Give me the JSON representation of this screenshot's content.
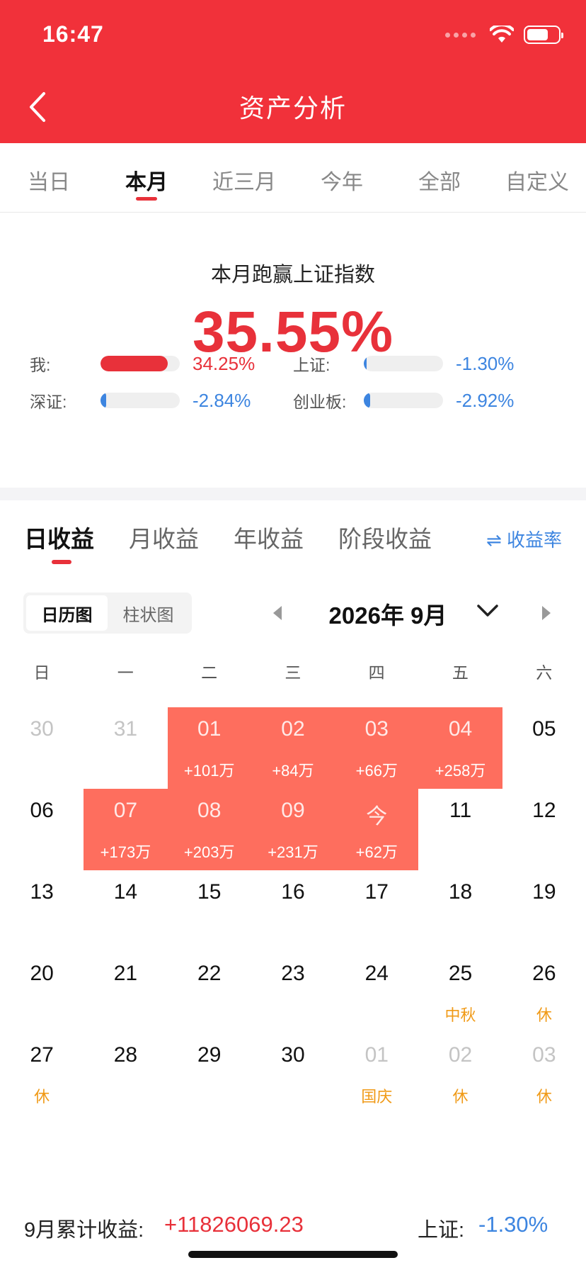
{
  "status": {
    "time": "16:47"
  },
  "header": {
    "title": "资产分析"
  },
  "period_tabs": [
    {
      "label": "当日",
      "active": false
    },
    {
      "label": "本月",
      "active": true
    },
    {
      "label": "近三月",
      "active": false
    },
    {
      "label": "今年",
      "active": false
    },
    {
      "label": "全部",
      "active": false
    },
    {
      "label": "自定义",
      "active": false
    }
  ],
  "summary": {
    "title": "本月跑赢上证指数",
    "value": "35.55%",
    "comparisons": [
      {
        "id": "me",
        "label": "我:",
        "value": "34.25%",
        "fill": 0.85,
        "color": "#e8313a",
        "tone": "red"
      },
      {
        "id": "sh",
        "label": "上证:",
        "value": "-1.30%",
        "fill": 0.03,
        "color": "#3d85e0",
        "tone": "blue"
      },
      {
        "id": "sz",
        "label": "深证:",
        "value": "-2.84%",
        "fill": 0.07,
        "color": "#3d85e0",
        "tone": "blue"
      },
      {
        "id": "cyb",
        "label": "创业板:",
        "value": "-2.92%",
        "fill": 0.08,
        "color": "#3d85e0",
        "tone": "blue"
      }
    ]
  },
  "earnings_tabs": [
    {
      "label": "日收益",
      "active": true
    },
    {
      "label": "月收益",
      "active": false
    },
    {
      "label": "年收益",
      "active": false
    },
    {
      "label": "阶段收益",
      "active": false
    }
  ],
  "rate_toggle": "⇌ 收益率",
  "view_toggle": {
    "calendar": "日历图",
    "bar": "柱状图"
  },
  "month_nav": {
    "label": "2026年 9月"
  },
  "weekdays": [
    "日",
    "一",
    "二",
    "三",
    "四",
    "五",
    "六"
  ],
  "calendar": [
    [
      {
        "day": "30",
        "other": true
      },
      {
        "day": "31",
        "other": true
      },
      {
        "day": "01",
        "gain": "+101万"
      },
      {
        "day": "02",
        "gain": "+84万"
      },
      {
        "day": "03",
        "gain": "+66万"
      },
      {
        "day": "04",
        "gain": "+258万"
      },
      {
        "day": "05"
      }
    ],
    [
      {
        "day": "06"
      },
      {
        "day": "07",
        "gain": "+173万"
      },
      {
        "day": "08",
        "gain": "+203万"
      },
      {
        "day": "09",
        "gain": "+231万"
      },
      {
        "day": "今",
        "gain": "+62万"
      },
      {
        "day": "11"
      },
      {
        "day": "12"
      }
    ],
    [
      {
        "day": "13"
      },
      {
        "day": "14"
      },
      {
        "day": "15"
      },
      {
        "day": "16"
      },
      {
        "day": "17"
      },
      {
        "day": "18"
      },
      {
        "day": "19"
      }
    ],
    [
      {
        "day": "20"
      },
      {
        "day": "21"
      },
      {
        "day": "22"
      },
      {
        "day": "23"
      },
      {
        "day": "24"
      },
      {
        "day": "25",
        "note": "中秋"
      },
      {
        "day": "26",
        "note": "休"
      }
    ],
    [
      {
        "day": "27",
        "note": "休"
      },
      {
        "day": "28"
      },
      {
        "day": "29"
      },
      {
        "day": "30"
      },
      {
        "day": "01",
        "other": true,
        "note": "国庆"
      },
      {
        "day": "02",
        "other": true,
        "note": "休"
      },
      {
        "day": "03",
        "other": true,
        "note": "休"
      }
    ]
  ],
  "footer": {
    "cumulative_label": "9月累计收益:",
    "cumulative_value": "+11826069.23",
    "index_label": "上证:",
    "index_value": "-1.30%"
  },
  "colors": {
    "brand_red": "#f1313a",
    "gain_cell": "#fe6e5e",
    "negative_blue": "#3d85e0",
    "holiday_orange": "#f09a17"
  },
  "icons": [
    "chevron-left-icon",
    "wifi-icon",
    "battery-icon",
    "signal-dots-icon",
    "swap-icon",
    "triangle-left-icon",
    "chevron-down-icon",
    "triangle-right-icon"
  ]
}
